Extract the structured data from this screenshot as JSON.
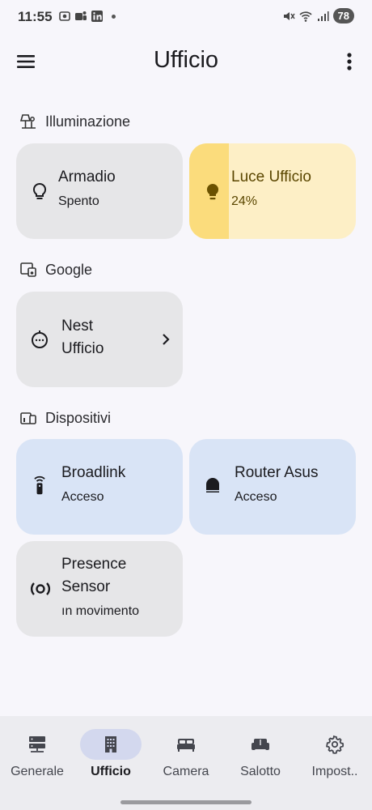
{
  "status_bar": {
    "time": "11:55",
    "icons_left": [
      "screenshot-icon",
      "teams-icon",
      "linkedin-icon",
      "dot-icon"
    ],
    "icons_right": [
      "mute-icon",
      "wifi-icon",
      "signal-icon"
    ],
    "battery": "78"
  },
  "app_bar": {
    "title": "Ufficio",
    "menu_icon": "hamburger-menu-icon",
    "more_icon": "more-vertical-icon"
  },
  "sections": {
    "illuminazione": {
      "title": "Illuminazione",
      "icon": "lamp-icon",
      "cards": [
        {
          "name": "Armadio",
          "state": "Spento",
          "icon": "bulb-outline-icon"
        },
        {
          "name": "Luce Ufficio",
          "state": "24%",
          "icon": "bulb-filled-icon",
          "brightness": 0.24
        }
      ]
    },
    "google": {
      "title": "Google",
      "icon": "speaker-devices-icon",
      "cards": [
        {
          "name_line1": "Nest",
          "name_line2": "Ufficio",
          "icon": "smart-speaker-icon"
        }
      ]
    },
    "dispositivi": {
      "title": "Dispositivi",
      "icon": "devices-icon",
      "cards": [
        {
          "name": "Broadlink",
          "state": "Acceso",
          "icon": "remote-icon"
        },
        {
          "name": "Router Asus",
          "state": "Acceso",
          "icon": "router-icon"
        },
        {
          "name_line1": "Presence",
          "name_line2": "Sensor",
          "state": "ın movimento",
          "icon": "sensor-icon"
        }
      ]
    }
  },
  "colors": {
    "background": "#f7f6fb",
    "card_off": "#e6e6e8",
    "card_on": "#d9e4f6",
    "light_card": "#fdefc6",
    "light_fill": "#fbdc7c",
    "nav_active": "#d3d8ee"
  },
  "bottom_nav": {
    "items": [
      {
        "label": "Generale",
        "icon": "server-icon"
      },
      {
        "label": "Ufficio",
        "icon": "office-building-icon",
        "active": true
      },
      {
        "label": "Camera",
        "icon": "bed-icon"
      },
      {
        "label": "Salotto",
        "icon": "sofa-icon"
      },
      {
        "label": "Impost..",
        "icon": "gear-icon"
      }
    ]
  }
}
